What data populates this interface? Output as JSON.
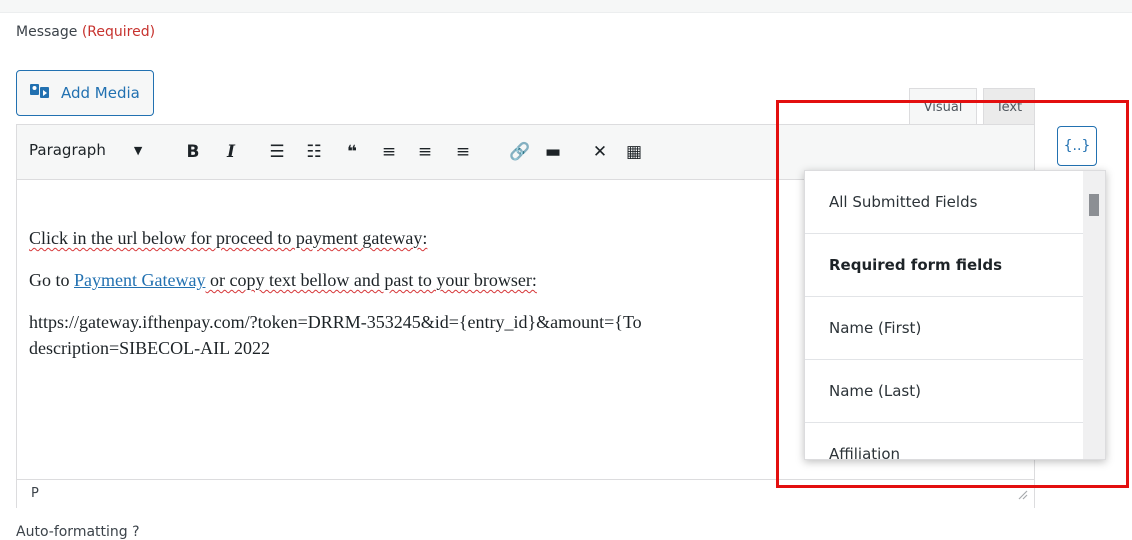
{
  "field": {
    "label": "Message",
    "required": "(Required)"
  },
  "add_media": {
    "label": "Add Media"
  },
  "tabs": {
    "visual": "Visual",
    "text": "Text"
  },
  "toolbar": {
    "format": "Paragraph",
    "buttons": [
      "bold-icon",
      "italic-icon",
      "bullet-list-icon",
      "numbered-list-icon",
      "blockquote-icon",
      "align-left-icon",
      "align-center-icon",
      "align-right-icon",
      "link-icon",
      "read-more-icon",
      "fullscreen-icon",
      "toolbar-toggle-icon"
    ]
  },
  "content": {
    "line1": "Click in the url below for proceed to payment gateway:",
    "line2_pre": "Go to ",
    "line2_link": "Payment Gateway",
    "line2_post": " or copy text bellow and past to your browser:",
    "line3": "https://gateway.ifthenpay.com/?token=DRRM-353245&id={entry_id}&amount={To",
    "line4": "description=SIBECOL-AIL 2022"
  },
  "statusbar": {
    "path": "P"
  },
  "autoformat": {
    "label": "Auto-formatting",
    "help": "?"
  },
  "merge_tags": {
    "button_label": "{..}",
    "items": [
      "All Submitted Fields",
      "Required form fields",
      "Name (First)",
      "Name (Last)",
      "Affiliation"
    ]
  },
  "colors": {
    "accent": "#2271b1",
    "highlight": "#e30f0f",
    "required": "#c7332f"
  }
}
